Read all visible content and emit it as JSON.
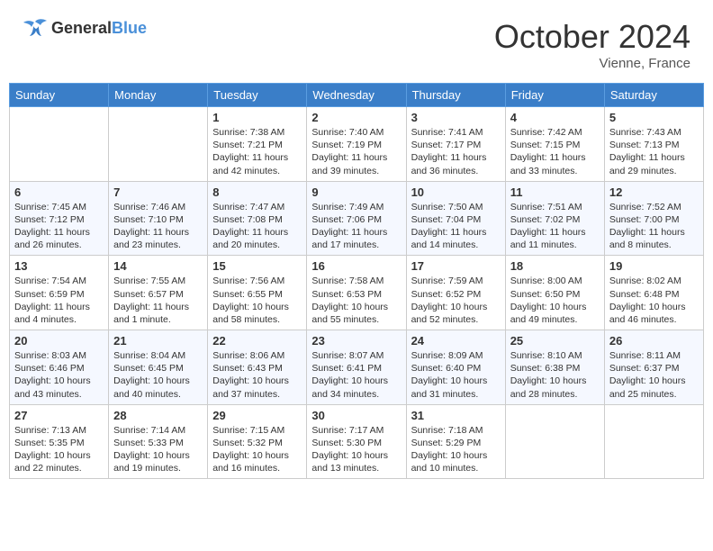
{
  "header": {
    "logo_general": "General",
    "logo_blue": "Blue",
    "month": "October 2024",
    "location": "Vienne, France"
  },
  "columns": [
    "Sunday",
    "Monday",
    "Tuesday",
    "Wednesday",
    "Thursday",
    "Friday",
    "Saturday"
  ],
  "weeks": [
    [
      {
        "day": "",
        "info": ""
      },
      {
        "day": "",
        "info": ""
      },
      {
        "day": "1",
        "info": "Sunrise: 7:38 AM\nSunset: 7:21 PM\nDaylight: 11 hours and 42 minutes."
      },
      {
        "day": "2",
        "info": "Sunrise: 7:40 AM\nSunset: 7:19 PM\nDaylight: 11 hours and 39 minutes."
      },
      {
        "day": "3",
        "info": "Sunrise: 7:41 AM\nSunset: 7:17 PM\nDaylight: 11 hours and 36 minutes."
      },
      {
        "day": "4",
        "info": "Sunrise: 7:42 AM\nSunset: 7:15 PM\nDaylight: 11 hours and 33 minutes."
      },
      {
        "day": "5",
        "info": "Sunrise: 7:43 AM\nSunset: 7:13 PM\nDaylight: 11 hours and 29 minutes."
      }
    ],
    [
      {
        "day": "6",
        "info": "Sunrise: 7:45 AM\nSunset: 7:12 PM\nDaylight: 11 hours and 26 minutes."
      },
      {
        "day": "7",
        "info": "Sunrise: 7:46 AM\nSunset: 7:10 PM\nDaylight: 11 hours and 23 minutes."
      },
      {
        "day": "8",
        "info": "Sunrise: 7:47 AM\nSunset: 7:08 PM\nDaylight: 11 hours and 20 minutes."
      },
      {
        "day": "9",
        "info": "Sunrise: 7:49 AM\nSunset: 7:06 PM\nDaylight: 11 hours and 17 minutes."
      },
      {
        "day": "10",
        "info": "Sunrise: 7:50 AM\nSunset: 7:04 PM\nDaylight: 11 hours and 14 minutes."
      },
      {
        "day": "11",
        "info": "Sunrise: 7:51 AM\nSunset: 7:02 PM\nDaylight: 11 hours and 11 minutes."
      },
      {
        "day": "12",
        "info": "Sunrise: 7:52 AM\nSunset: 7:00 PM\nDaylight: 11 hours and 8 minutes."
      }
    ],
    [
      {
        "day": "13",
        "info": "Sunrise: 7:54 AM\nSunset: 6:59 PM\nDaylight: 11 hours and 4 minutes."
      },
      {
        "day": "14",
        "info": "Sunrise: 7:55 AM\nSunset: 6:57 PM\nDaylight: 11 hours and 1 minute."
      },
      {
        "day": "15",
        "info": "Sunrise: 7:56 AM\nSunset: 6:55 PM\nDaylight: 10 hours and 58 minutes."
      },
      {
        "day": "16",
        "info": "Sunrise: 7:58 AM\nSunset: 6:53 PM\nDaylight: 10 hours and 55 minutes."
      },
      {
        "day": "17",
        "info": "Sunrise: 7:59 AM\nSunset: 6:52 PM\nDaylight: 10 hours and 52 minutes."
      },
      {
        "day": "18",
        "info": "Sunrise: 8:00 AM\nSunset: 6:50 PM\nDaylight: 10 hours and 49 minutes."
      },
      {
        "day": "19",
        "info": "Sunrise: 8:02 AM\nSunset: 6:48 PM\nDaylight: 10 hours and 46 minutes."
      }
    ],
    [
      {
        "day": "20",
        "info": "Sunrise: 8:03 AM\nSunset: 6:46 PM\nDaylight: 10 hours and 43 minutes."
      },
      {
        "day": "21",
        "info": "Sunrise: 8:04 AM\nSunset: 6:45 PM\nDaylight: 10 hours and 40 minutes."
      },
      {
        "day": "22",
        "info": "Sunrise: 8:06 AM\nSunset: 6:43 PM\nDaylight: 10 hours and 37 minutes."
      },
      {
        "day": "23",
        "info": "Sunrise: 8:07 AM\nSunset: 6:41 PM\nDaylight: 10 hours and 34 minutes."
      },
      {
        "day": "24",
        "info": "Sunrise: 8:09 AM\nSunset: 6:40 PM\nDaylight: 10 hours and 31 minutes."
      },
      {
        "day": "25",
        "info": "Sunrise: 8:10 AM\nSunset: 6:38 PM\nDaylight: 10 hours and 28 minutes."
      },
      {
        "day": "26",
        "info": "Sunrise: 8:11 AM\nSunset: 6:37 PM\nDaylight: 10 hours and 25 minutes."
      }
    ],
    [
      {
        "day": "27",
        "info": "Sunrise: 7:13 AM\nSunset: 5:35 PM\nDaylight: 10 hours and 22 minutes."
      },
      {
        "day": "28",
        "info": "Sunrise: 7:14 AM\nSunset: 5:33 PM\nDaylight: 10 hours and 19 minutes."
      },
      {
        "day": "29",
        "info": "Sunrise: 7:15 AM\nSunset: 5:32 PM\nDaylight: 10 hours and 16 minutes."
      },
      {
        "day": "30",
        "info": "Sunrise: 7:17 AM\nSunset: 5:30 PM\nDaylight: 10 hours and 13 minutes."
      },
      {
        "day": "31",
        "info": "Sunrise: 7:18 AM\nSunset: 5:29 PM\nDaylight: 10 hours and 10 minutes."
      },
      {
        "day": "",
        "info": ""
      },
      {
        "day": "",
        "info": ""
      }
    ]
  ]
}
